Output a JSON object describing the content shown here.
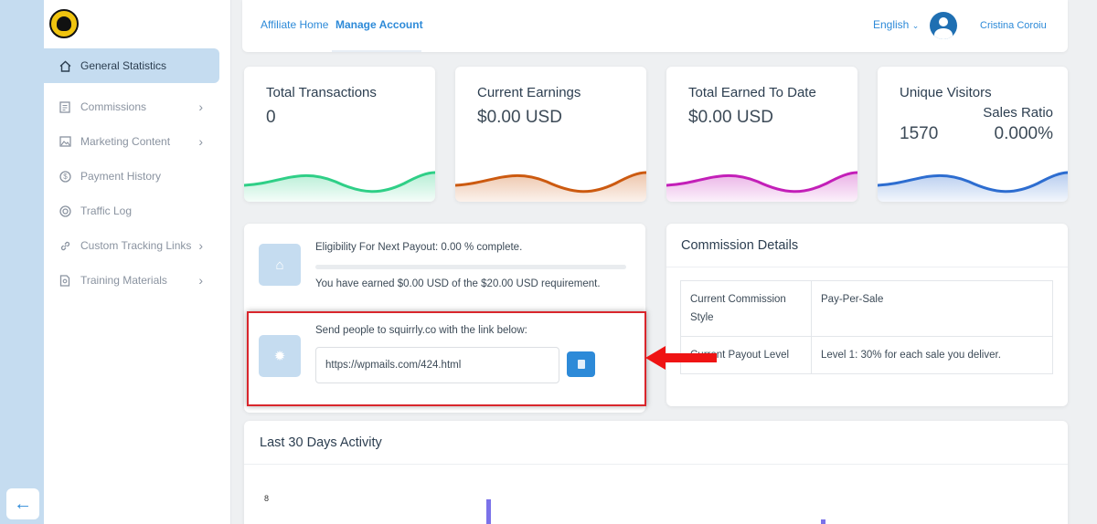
{
  "nav": {
    "items": [
      {
        "label": "General Statistics",
        "icon": "home-icon"
      },
      {
        "label": "Commissions",
        "icon": "commissions-icon"
      },
      {
        "label": "Marketing Content",
        "icon": "image-icon"
      },
      {
        "label": "Payment History",
        "icon": "dollar-icon"
      },
      {
        "label": "Traffic Log",
        "icon": "target-icon"
      },
      {
        "label": "Custom Tracking Links",
        "icon": "link-icon"
      },
      {
        "label": "Training Materials",
        "icon": "document-icon"
      }
    ]
  },
  "header": {
    "tabs": [
      "Affiliate Home",
      "Manage Account"
    ],
    "language": "English",
    "user_name": "Cristina Coroiu"
  },
  "stats": {
    "total_transactions": {
      "title": "Total Transactions",
      "value": "0",
      "color": "#2fcf87"
    },
    "current_earnings": {
      "title": "Current Earnings",
      "value": "$0.00 USD",
      "color": "#cc5a10"
    },
    "total_earned": {
      "title": "Total Earned To Date",
      "value": "$0.00 USD",
      "color": "#c31fb8"
    },
    "unique_visitors": {
      "title": "Unique Visitors",
      "value": "1570",
      "ratio_label": "Sales Ratio",
      "ratio_value": "0.000%",
      "color": "#2d6dd0"
    }
  },
  "payout": {
    "eligibility": "Eligibility For Next Payout: 0.00 % complete.",
    "progress": 0.0,
    "earned_text": "You have earned $0.00 USD of the $20.00 USD requirement.",
    "send_text": "Send people to squirrly.co with the link below:",
    "link": "https://wpmails.com/424.html"
  },
  "commission": {
    "title": "Commission Details",
    "rows": [
      {
        "label": "Current Commission Style",
        "value": "Pay-Per-Sale"
      },
      {
        "label": "Current Payout Level",
        "value": "Level 1: 30% for each sale you deliver."
      }
    ]
  },
  "activity": {
    "title": "Last 30 Days Activity",
    "y_tick": "8"
  },
  "colors": {
    "accent": "#2d8ad8",
    "highlight_border": "#d9262c"
  }
}
